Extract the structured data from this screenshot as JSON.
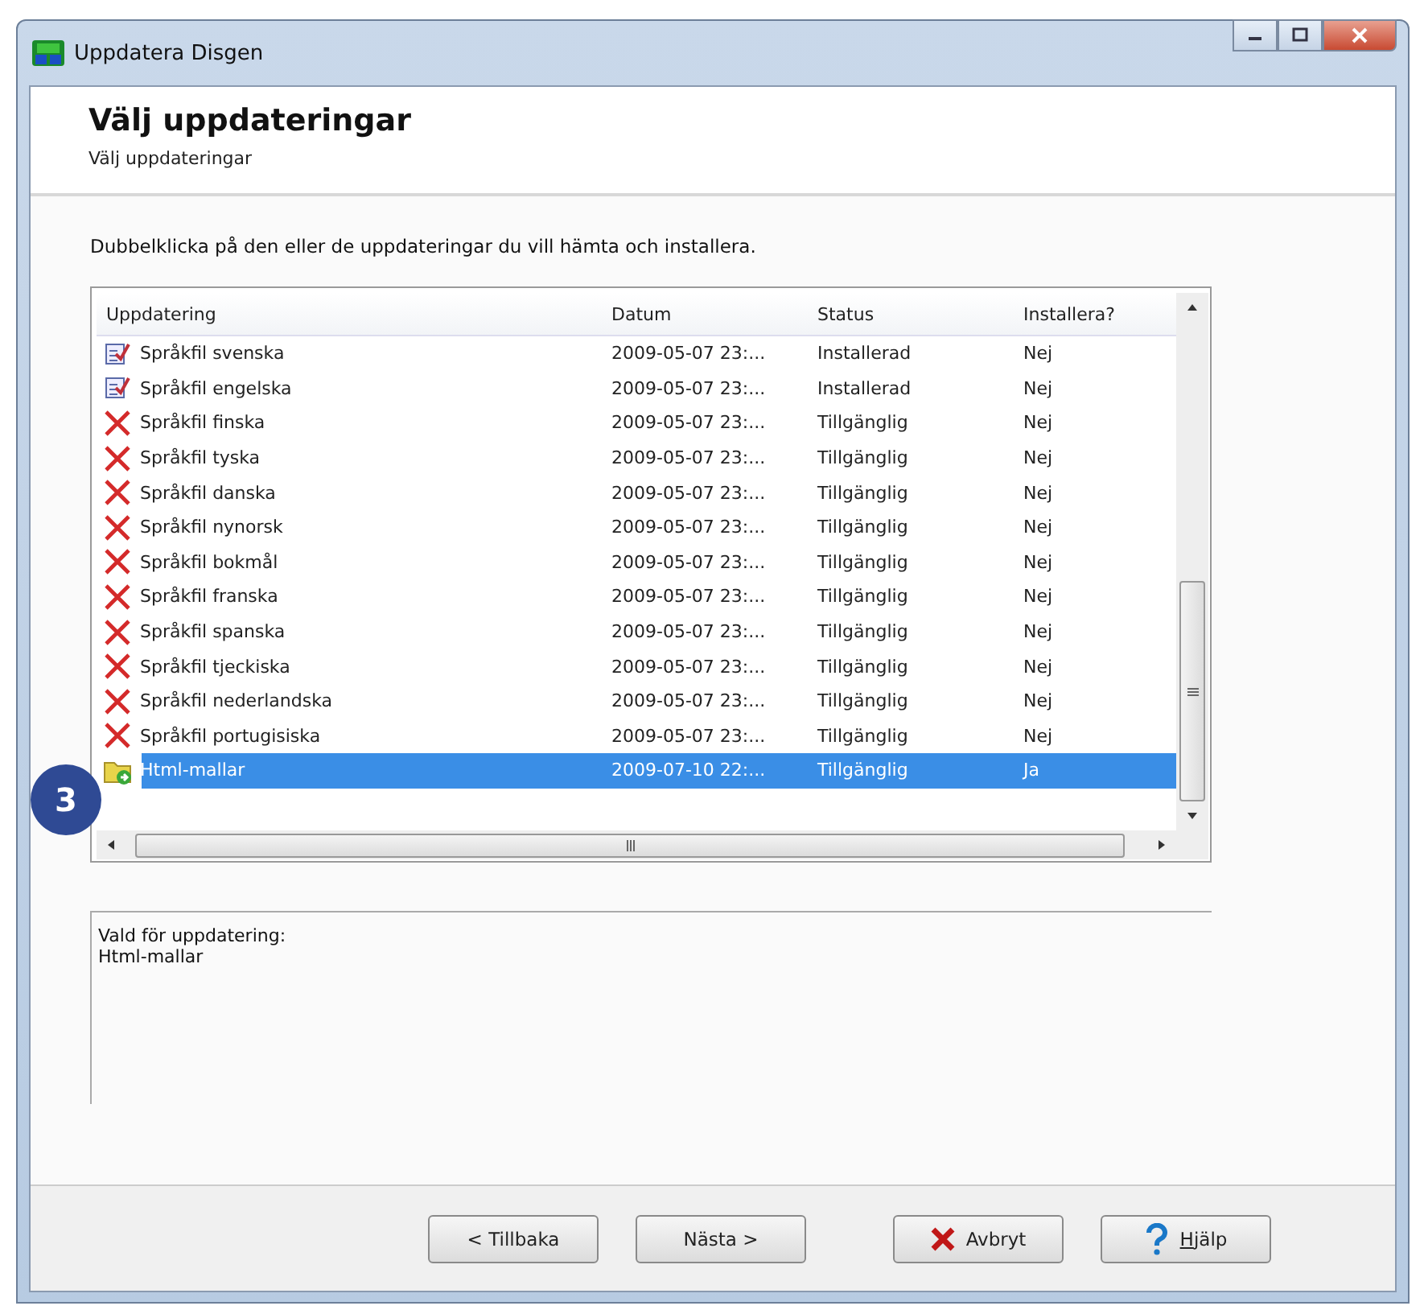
{
  "window": {
    "title": "Uppdatera Disgen"
  },
  "header": {
    "title": "Välj uppdateringar",
    "subtitle": "Välj uppdateringar"
  },
  "instruction": "Dubbelklicka på den eller de uppdateringar du vill hämta och installera.",
  "table": {
    "columns": [
      "Uppdatering",
      "Datum",
      "Status",
      "Installera?"
    ],
    "rows": [
      {
        "kind": "installed",
        "name": "Språkfil svenska",
        "date": "2009-05-07 23:...",
        "status": "Installerad",
        "install": "Nej",
        "selected": false
      },
      {
        "kind": "installed",
        "name": "Språkfil engelska",
        "date": "2009-05-07 23:...",
        "status": "Installerad",
        "install": "Nej",
        "selected": false
      },
      {
        "kind": "available",
        "name": "Språkfil finska",
        "date": "2009-05-07 23:...",
        "status": "Tillgänglig",
        "install": "Nej",
        "selected": false
      },
      {
        "kind": "available",
        "name": "Språkfil tyska",
        "date": "2009-05-07 23:...",
        "status": "Tillgänglig",
        "install": "Nej",
        "selected": false
      },
      {
        "kind": "available",
        "name": "Språkfil danska",
        "date": "2009-05-07 23:...",
        "status": "Tillgänglig",
        "install": "Nej",
        "selected": false
      },
      {
        "kind": "available",
        "name": "Språkfil nynorsk",
        "date": "2009-05-07 23:...",
        "status": "Tillgänglig",
        "install": "Nej",
        "selected": false
      },
      {
        "kind": "available",
        "name": "Språkfil bokmål",
        "date": "2009-05-07 23:...",
        "status": "Tillgänglig",
        "install": "Nej",
        "selected": false
      },
      {
        "kind": "available",
        "name": "Språkfil franska",
        "date": "2009-05-07 23:...",
        "status": "Tillgänglig",
        "install": "Nej",
        "selected": false
      },
      {
        "kind": "available",
        "name": "Språkfil spanska",
        "date": "2009-05-07 23:...",
        "status": "Tillgänglig",
        "install": "Nej",
        "selected": false
      },
      {
        "kind": "available",
        "name": "Språkfil tjeckiska",
        "date": "2009-05-07 23:...",
        "status": "Tillgänglig",
        "install": "Nej",
        "selected": false
      },
      {
        "kind": "available",
        "name": "Språkfil nederlandska",
        "date": "2009-05-07 23:...",
        "status": "Tillgänglig",
        "install": "Nej",
        "selected": false
      },
      {
        "kind": "available",
        "name": "Språkfil portugisiska",
        "date": "2009-05-07 23:...",
        "status": "Tillgänglig",
        "install": "Nej",
        "selected": false
      },
      {
        "kind": "chosen",
        "name": "Html-mallar",
        "date": "2009-07-10 22:...",
        "status": "Tillgänglig",
        "install": "Ja",
        "selected": true
      }
    ]
  },
  "summary": {
    "label": "Vald för uppdatering:",
    "items": [
      "Html-mallar"
    ]
  },
  "buttons": [
    {
      "kind": "back",
      "label": "< Tillbaka"
    },
    {
      "kind": "next",
      "label": "Nästa >"
    },
    {
      "kind": "cancel",
      "label": "Avbryt"
    },
    {
      "kind": "help",
      "label": "Hjälp"
    }
  ],
  "callout": "3"
}
